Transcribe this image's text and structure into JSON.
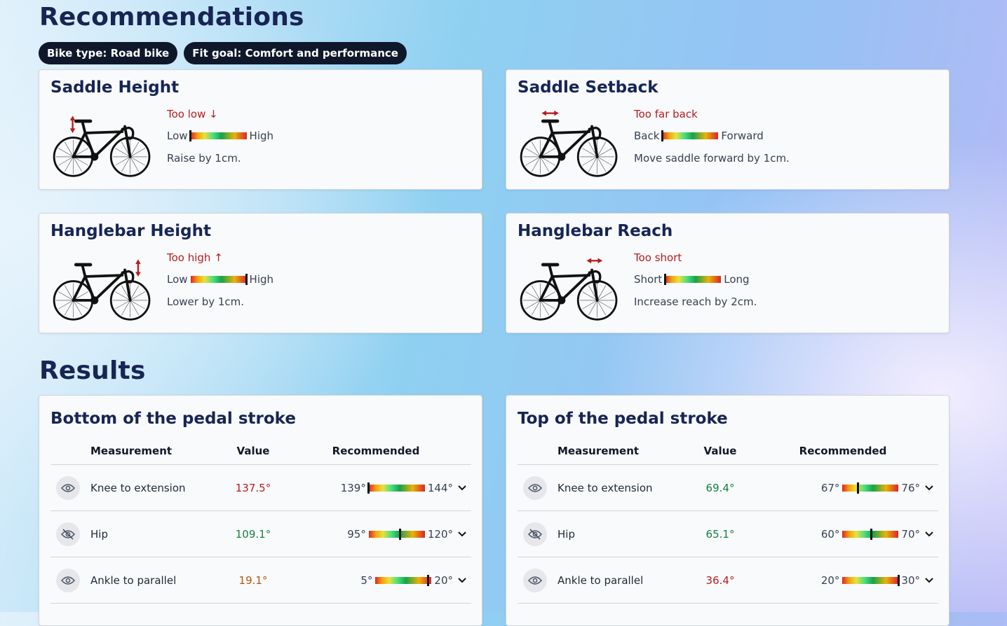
{
  "recommendations": {
    "heading": "Recommendations",
    "tags": [
      "Bike type: Road bike",
      "Fit goal: Comfort and performance"
    ],
    "cards": [
      {
        "title": "Saddle Height",
        "status": "Too low ↓",
        "low": "Low",
        "high": "High",
        "marker": 0.0,
        "message": "Raise by 1cm.",
        "highlight": "saddle-height"
      },
      {
        "title": "Saddle Setback",
        "status": "Too far back",
        "low": "Back",
        "high": "Forward",
        "marker": 0.0,
        "message": "Move saddle forward by 1cm.",
        "highlight": "saddle-setback"
      },
      {
        "title": "Hanglebar Height",
        "status": "Too high ↑",
        "low": "Low",
        "high": "High",
        "marker": 1.0,
        "message": "Lower by 1cm.",
        "highlight": "bar-height"
      },
      {
        "title": "Hanglebar Reach",
        "status": "Too short",
        "low": "Short",
        "high": "Long",
        "marker": 0.0,
        "message": "Increase reach by 2cm.",
        "highlight": "bar-reach"
      }
    ]
  },
  "results": {
    "heading": "Results",
    "columns": {
      "measurement": "Measurement",
      "value": "Value",
      "recommended": "Recommended"
    },
    "tables": [
      {
        "title": "Bottom of the pedal stroke",
        "rows": [
          {
            "name": "Knee to extension",
            "value": "137.5°",
            "value_color": "#b91c1c",
            "min": "139°",
            "max": "144°",
            "marker": 0.0,
            "eye": "eye-icon"
          },
          {
            "name": "Hip",
            "value": "109.1°",
            "value_color": "#15803d",
            "min": "95°",
            "max": "120°",
            "marker": 0.56,
            "eye": "eye-off-icon"
          },
          {
            "name": "Ankle to parallel",
            "value": "19.1°",
            "value_color": "#b45309",
            "min": "5°",
            "max": "20°",
            "marker": 0.94,
            "eye": "eye-icon"
          }
        ]
      },
      {
        "title": "Top of the pedal stroke",
        "rows": [
          {
            "name": "Knee to extension",
            "value": "69.4°",
            "value_color": "#15803d",
            "min": "67°",
            "max": "76°",
            "marker": 0.27,
            "eye": "eye-icon"
          },
          {
            "name": "Hip",
            "value": "65.1°",
            "value_color": "#15803d",
            "min": "60°",
            "max": "70°",
            "marker": 0.51,
            "eye": "eye-off-icon"
          },
          {
            "name": "Ankle to parallel",
            "value": "36.4°",
            "value_color": "#b91c1c",
            "min": "20°",
            "max": "30°",
            "marker": 1.0,
            "eye": "eye-icon"
          }
        ]
      }
    ]
  }
}
